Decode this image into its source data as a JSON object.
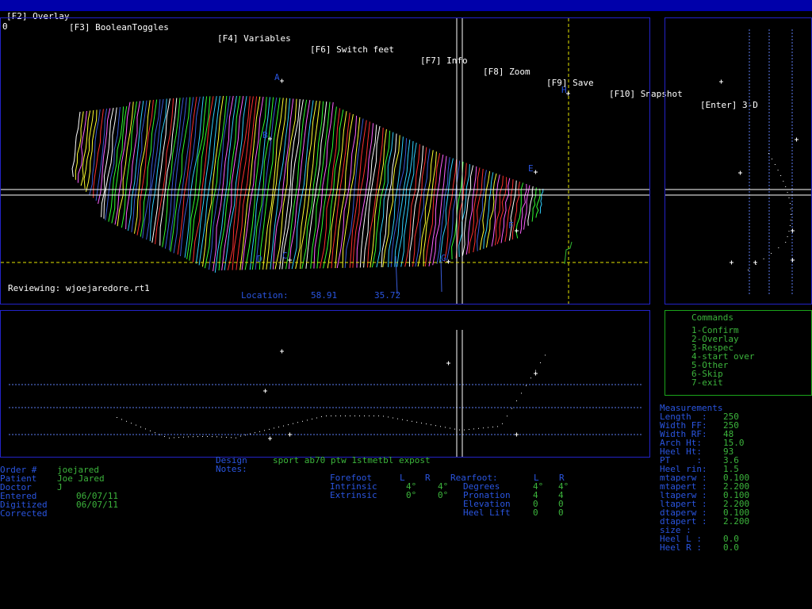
{
  "menu": [
    "[F2] Overlay",
    "[F3] BooleanToggles",
    "[F4] Variables",
    "[F6] Switch feet",
    "[F7] Info",
    "[F8] Zoom",
    "[F9] Save",
    "[F10] Snapshot",
    "[Enter] 3-D"
  ],
  "top_view": {
    "corner_label": "0",
    "reviewing": "Reviewing: wjoejaredore.rt1",
    "location_label": "Location:",
    "location_x": "58.91",
    "location_y": "35.72",
    "points": [
      "A",
      "B",
      "H",
      "E",
      "F",
      "D",
      "C",
      "G"
    ]
  },
  "commands": {
    "title": "Commands",
    "items": [
      "1-Confirm",
      "2-Overlay",
      "3-Respec",
      "4-start over",
      "5-Other",
      "6-Skip",
      "7-exit"
    ]
  },
  "measurements": {
    "title": "Measurements",
    "rows": [
      {
        "label": "Length  :",
        "value": "250"
      },
      {
        "label": "Width FF:",
        "value": "250"
      },
      {
        "label": "Width RF:",
        "value": "48"
      },
      {
        "label": "Arch Ht:",
        "value": "15.0"
      },
      {
        "label": "Heel Ht:",
        "value": "93"
      },
      {
        "label": "PT     :",
        "value": "3.6"
      },
      {
        "label": "Heel rin:",
        "value": "1.5"
      },
      {
        "label": "mtaperw :",
        "value": "0.100"
      },
      {
        "label": "mtapert :",
        "value": "2.200"
      },
      {
        "label": "ltaperw :",
        "value": "0.100"
      },
      {
        "label": "ltapert :",
        "value": "2.200"
      },
      {
        "label": "dtaperw :",
        "value": "0.100"
      },
      {
        "label": "dtapert :",
        "value": "2.200"
      },
      {
        "label": "size :",
        "value": ""
      },
      {
        "label": "Heel L :",
        "value": "0.0"
      },
      {
        "label": "Heel R :",
        "value": "0.0"
      }
    ]
  },
  "order": {
    "rows": [
      {
        "label": "Order #",
        "value": "joejared"
      },
      {
        "label": "Patient",
        "value": "Joe Jared"
      },
      {
        "label": "Doctor",
        "value": "J"
      },
      {
        "label": "Entered",
        "value": "06/07/11"
      },
      {
        "label": "Digitized",
        "value": "06/07/11"
      },
      {
        "label": "Corrected",
        "value": ""
      }
    ]
  },
  "design": {
    "design_label": "Design",
    "design_value": "sport ab70 ptw 1stmetbl expost",
    "notes_label": "Notes:"
  },
  "forefoot": {
    "title": "Forefoot",
    "col_l": "L",
    "col_r": "R",
    "rows": [
      {
        "label": "Intrinsic",
        "l": "4°",
        "r": "4°"
      },
      {
        "label": "Extrinsic",
        "l": "0°",
        "r": "0°"
      }
    ]
  },
  "rearfoot": {
    "title": "Rearfoot:",
    "col_l": "L",
    "col_r": "R",
    "rows": [
      {
        "label": "Degrees",
        "l": "4°",
        "r": "4°"
      },
      {
        "label": "Pronation",
        "l": "4",
        "r": "4"
      },
      {
        "label": "Elevation",
        "l": "0",
        "r": "0"
      },
      {
        "label": "Heel Lift",
        "l": "0",
        "r": "0"
      }
    ]
  }
}
